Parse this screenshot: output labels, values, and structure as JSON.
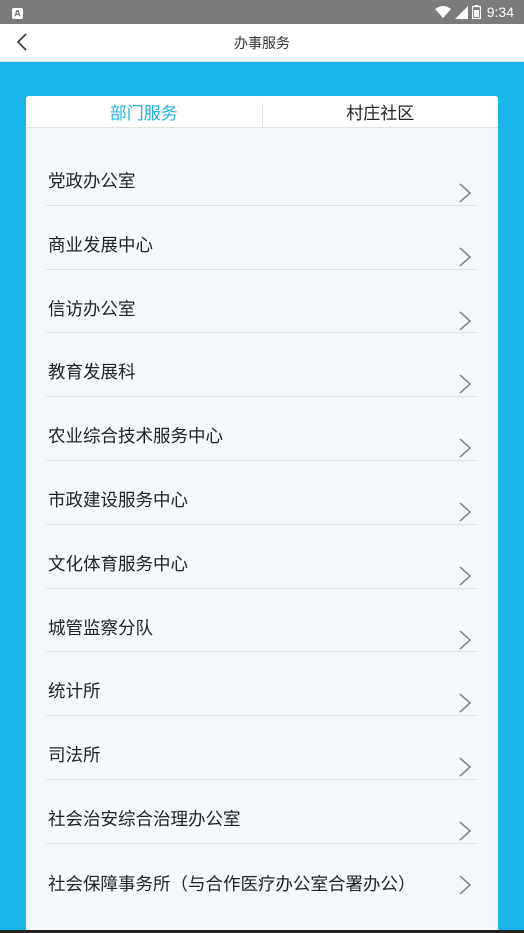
{
  "status_bar": {
    "time": "9:34",
    "app_icon_letter": "A",
    "icons": [
      "wifi-icon",
      "cell-signal-icon",
      "battery-icon"
    ]
  },
  "header": {
    "title": "办事服务",
    "back_icon": "chevron-left-icon"
  },
  "tabs": [
    {
      "label": "部门服务",
      "active": true
    },
    {
      "label": "村庄社区",
      "active": false
    }
  ],
  "list": {
    "items": [
      {
        "label": "党政办公室"
      },
      {
        "label": "商业发展中心"
      },
      {
        "label": "信访办公室"
      },
      {
        "label": "教育发展科"
      },
      {
        "label": "农业综合技术服务中心"
      },
      {
        "label": "市政建设服务中心"
      },
      {
        "label": "文化体育服务中心"
      },
      {
        "label": "城管监察分队"
      },
      {
        "label": "统计所"
      },
      {
        "label": "司法所"
      },
      {
        "label": "社会治安综合治理办公室"
      },
      {
        "label": "社会保障事务所（与合作医疗办公室合署办公）"
      }
    ],
    "item_icon": "chevron-right-icon"
  },
  "colors": {
    "accent": "#1eb3e9",
    "background_blue": "#1ab5ea",
    "status_bar": "#7b7b7b",
    "card": "#f3f9fc"
  }
}
